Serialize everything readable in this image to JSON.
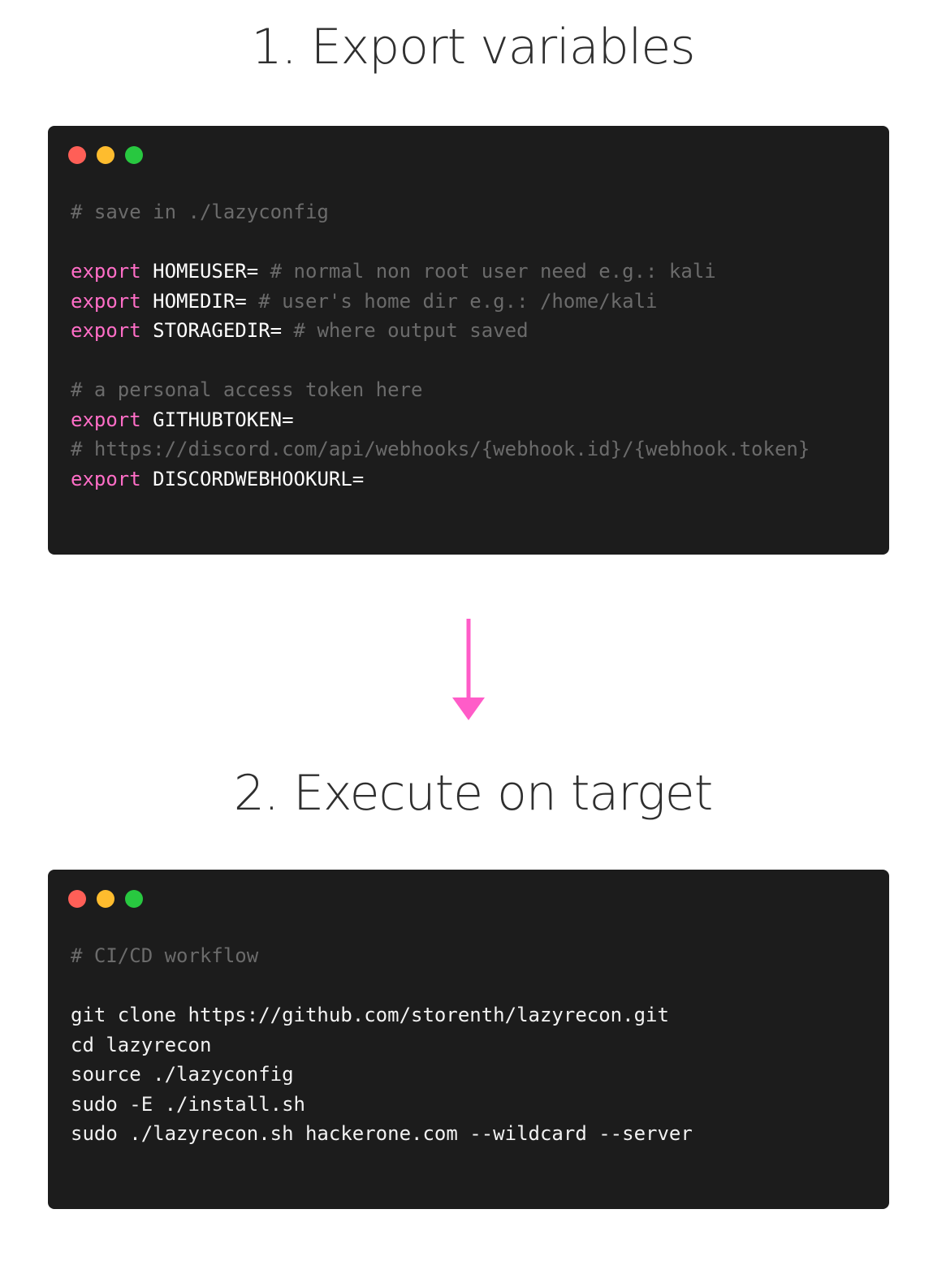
{
  "step1": {
    "title": "1. Export variables",
    "lines": [
      {
        "comment": "# save in ./lazyconfig"
      },
      {},
      {
        "keyword": "export",
        "var": " HOMEUSER=",
        "comment": " # normal non root user need e.g.: kali"
      },
      {
        "keyword": "export",
        "var": " HOMEDIR=",
        "comment": " # user's home dir e.g.: /home/kali"
      },
      {
        "keyword": "export",
        "var": " STORAGEDIR=",
        "comment": " # where output saved"
      },
      {},
      {
        "comment": "# a personal access token here"
      },
      {
        "keyword": "export",
        "var": " GITHUBTOKEN="
      },
      {
        "comment": "# https://discord.com/api/webhooks/{webhook.id}/{webhook.token}"
      },
      {
        "keyword": "export",
        "var": " DISCORDWEBHOOKURL="
      }
    ]
  },
  "step2": {
    "title": "2. Execute on target",
    "lines": [
      {
        "comment": "# CI/CD workflow"
      },
      {},
      {
        "plain": "git clone https://github.com/storenth/lazyrecon.git"
      },
      {
        "plain": "cd lazyrecon"
      },
      {
        "plain": "source ./lazyconfig"
      },
      {
        "plain": "sudo -E ./install.sh"
      },
      {
        "plain": "sudo ./lazyrecon.sh hackerone.com --wildcard --server"
      }
    ]
  },
  "colors": {
    "background": "#ffffff",
    "code_background": "#1c1c1c",
    "keyword": "#ff6ec7",
    "comment": "#6b6b6b",
    "identifier": "#ffffff",
    "arrow": "#ff5cc8",
    "dot_red": "#ff5f57",
    "dot_yellow": "#febc2e",
    "dot_green": "#28c840"
  },
  "icons": {
    "window_controls": [
      "close-dot",
      "minimize-dot",
      "maximize-dot"
    ],
    "connector": "down-arrow-icon"
  }
}
